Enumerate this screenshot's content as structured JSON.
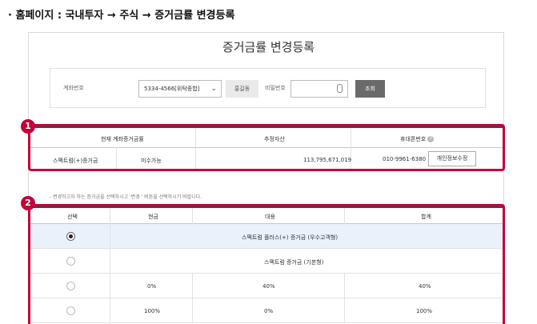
{
  "breadcrumb": "· 홈페이지 : 국내투자 → 주식 → 증거금률 변경등록",
  "page_title": "증거금률 변경등록",
  "form": {
    "account_label": "계좌번호",
    "account_value": "5334-4566[위탁종합]",
    "holder_name": "홍길동",
    "password_label": "비밀번호",
    "password_value": "",
    "search_button": "조회"
  },
  "info": {
    "headers": [
      "현재 계좌증거금률",
      "추정자산",
      "휴대폰번호"
    ],
    "current_grade": "스펙트럼(+)증거금",
    "change_status": "미수가능",
    "estimated_assets": "113,795,671,019",
    "phone": "010-9961-6380",
    "edit_button": "개인정보수정"
  },
  "badges": [
    "1",
    "2"
  ],
  "notice": "- 변경하고자 하는 증거금을 선택하시고 '변경 ' 버튼을 선택하시기 바랍니다.",
  "grade_table": {
    "headers": [
      "선택",
      "현금",
      "대용",
      "합계"
    ],
    "rows": [
      {
        "selected": true,
        "merged": "스펙트럼 플러스(+) 증거금 (우수고객형)"
      },
      {
        "selected": false,
        "merged": "스펙트럼 증거금 (기본형)"
      },
      {
        "selected": false,
        "cash": "0%",
        "substitute": "40%",
        "total": "40%"
      },
      {
        "selected": false,
        "cash": "100%",
        "substitute": "0%",
        "total": "100%"
      }
    ]
  },
  "colors": {
    "highlight": "#c4003a",
    "button_dark": "#6a6a6a",
    "selected_row": "#eaf1fb"
  }
}
